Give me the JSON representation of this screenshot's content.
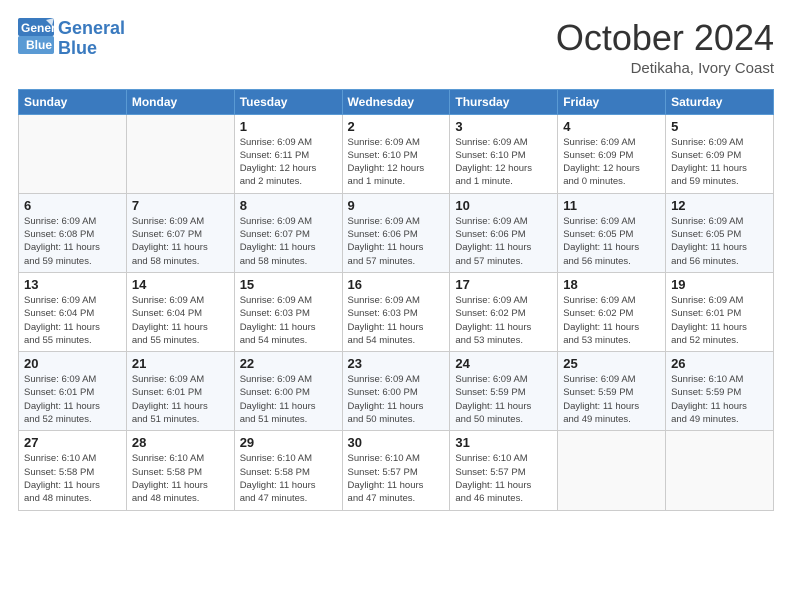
{
  "logo": {
    "line1": "General",
    "line2": "Blue"
  },
  "title": "October 2024",
  "subtitle": "Detikaha, Ivory Coast",
  "header_days": [
    "Sunday",
    "Monday",
    "Tuesday",
    "Wednesday",
    "Thursday",
    "Friday",
    "Saturday"
  ],
  "weeks": [
    [
      {
        "num": "",
        "info": ""
      },
      {
        "num": "",
        "info": ""
      },
      {
        "num": "1",
        "info": "Sunrise: 6:09 AM\nSunset: 6:11 PM\nDaylight: 12 hours\nand 2 minutes."
      },
      {
        "num": "2",
        "info": "Sunrise: 6:09 AM\nSunset: 6:10 PM\nDaylight: 12 hours\nand 1 minute."
      },
      {
        "num": "3",
        "info": "Sunrise: 6:09 AM\nSunset: 6:10 PM\nDaylight: 12 hours\nand 1 minute."
      },
      {
        "num": "4",
        "info": "Sunrise: 6:09 AM\nSunset: 6:09 PM\nDaylight: 12 hours\nand 0 minutes."
      },
      {
        "num": "5",
        "info": "Sunrise: 6:09 AM\nSunset: 6:09 PM\nDaylight: 11 hours\nand 59 minutes."
      }
    ],
    [
      {
        "num": "6",
        "info": "Sunrise: 6:09 AM\nSunset: 6:08 PM\nDaylight: 11 hours\nand 59 minutes."
      },
      {
        "num": "7",
        "info": "Sunrise: 6:09 AM\nSunset: 6:07 PM\nDaylight: 11 hours\nand 58 minutes."
      },
      {
        "num": "8",
        "info": "Sunrise: 6:09 AM\nSunset: 6:07 PM\nDaylight: 11 hours\nand 58 minutes."
      },
      {
        "num": "9",
        "info": "Sunrise: 6:09 AM\nSunset: 6:06 PM\nDaylight: 11 hours\nand 57 minutes."
      },
      {
        "num": "10",
        "info": "Sunrise: 6:09 AM\nSunset: 6:06 PM\nDaylight: 11 hours\nand 57 minutes."
      },
      {
        "num": "11",
        "info": "Sunrise: 6:09 AM\nSunset: 6:05 PM\nDaylight: 11 hours\nand 56 minutes."
      },
      {
        "num": "12",
        "info": "Sunrise: 6:09 AM\nSunset: 6:05 PM\nDaylight: 11 hours\nand 56 minutes."
      }
    ],
    [
      {
        "num": "13",
        "info": "Sunrise: 6:09 AM\nSunset: 6:04 PM\nDaylight: 11 hours\nand 55 minutes."
      },
      {
        "num": "14",
        "info": "Sunrise: 6:09 AM\nSunset: 6:04 PM\nDaylight: 11 hours\nand 55 minutes."
      },
      {
        "num": "15",
        "info": "Sunrise: 6:09 AM\nSunset: 6:03 PM\nDaylight: 11 hours\nand 54 minutes."
      },
      {
        "num": "16",
        "info": "Sunrise: 6:09 AM\nSunset: 6:03 PM\nDaylight: 11 hours\nand 54 minutes."
      },
      {
        "num": "17",
        "info": "Sunrise: 6:09 AM\nSunset: 6:02 PM\nDaylight: 11 hours\nand 53 minutes."
      },
      {
        "num": "18",
        "info": "Sunrise: 6:09 AM\nSunset: 6:02 PM\nDaylight: 11 hours\nand 53 minutes."
      },
      {
        "num": "19",
        "info": "Sunrise: 6:09 AM\nSunset: 6:01 PM\nDaylight: 11 hours\nand 52 minutes."
      }
    ],
    [
      {
        "num": "20",
        "info": "Sunrise: 6:09 AM\nSunset: 6:01 PM\nDaylight: 11 hours\nand 52 minutes."
      },
      {
        "num": "21",
        "info": "Sunrise: 6:09 AM\nSunset: 6:01 PM\nDaylight: 11 hours\nand 51 minutes."
      },
      {
        "num": "22",
        "info": "Sunrise: 6:09 AM\nSunset: 6:00 PM\nDaylight: 11 hours\nand 51 minutes."
      },
      {
        "num": "23",
        "info": "Sunrise: 6:09 AM\nSunset: 6:00 PM\nDaylight: 11 hours\nand 50 minutes."
      },
      {
        "num": "24",
        "info": "Sunrise: 6:09 AM\nSunset: 5:59 PM\nDaylight: 11 hours\nand 50 minutes."
      },
      {
        "num": "25",
        "info": "Sunrise: 6:09 AM\nSunset: 5:59 PM\nDaylight: 11 hours\nand 49 minutes."
      },
      {
        "num": "26",
        "info": "Sunrise: 6:10 AM\nSunset: 5:59 PM\nDaylight: 11 hours\nand 49 minutes."
      }
    ],
    [
      {
        "num": "27",
        "info": "Sunrise: 6:10 AM\nSunset: 5:58 PM\nDaylight: 11 hours\nand 48 minutes."
      },
      {
        "num": "28",
        "info": "Sunrise: 6:10 AM\nSunset: 5:58 PM\nDaylight: 11 hours\nand 48 minutes."
      },
      {
        "num": "29",
        "info": "Sunrise: 6:10 AM\nSunset: 5:58 PM\nDaylight: 11 hours\nand 47 minutes."
      },
      {
        "num": "30",
        "info": "Sunrise: 6:10 AM\nSunset: 5:57 PM\nDaylight: 11 hours\nand 47 minutes."
      },
      {
        "num": "31",
        "info": "Sunrise: 6:10 AM\nSunset: 5:57 PM\nDaylight: 11 hours\nand 46 minutes."
      },
      {
        "num": "",
        "info": ""
      },
      {
        "num": "",
        "info": ""
      }
    ]
  ]
}
